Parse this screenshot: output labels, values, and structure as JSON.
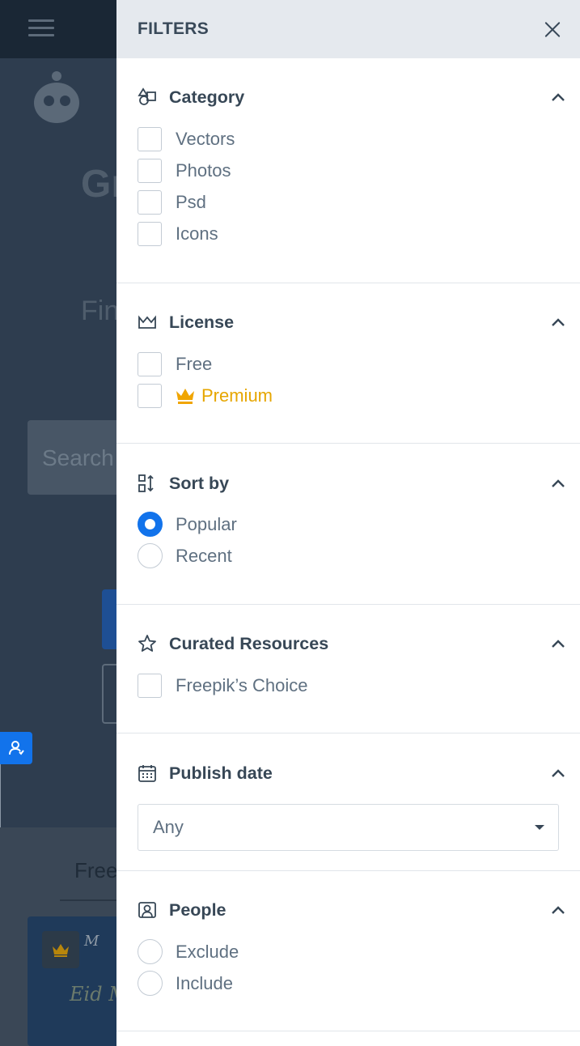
{
  "background": {
    "heading_fragment": "Gr",
    "subheading_fragment": "Fin",
    "search_placeholder": "Search",
    "tab_label": "Free",
    "card_title_fragment": "cial M",
    "card_subtitle_fragment": "Eid M"
  },
  "filters": {
    "title": "FILTERS",
    "close_icon": "close-icon",
    "sections": {
      "category": {
        "title": "Category",
        "icon": "shapes-icon",
        "options": [
          "Vectors",
          "Photos",
          "Psd",
          "Icons"
        ]
      },
      "license": {
        "title": "License",
        "icon": "crown-outline-icon",
        "options": [
          "Free",
          "Premium"
        ],
        "premium_color": "#e6a600"
      },
      "sort": {
        "title": "Sort by",
        "icon": "sort-icon",
        "options": [
          "Popular",
          "Recent"
        ],
        "selected": "Popular",
        "accent_color": "#1273eb"
      },
      "curated": {
        "title": "Curated Resources",
        "icon": "star-icon",
        "options": [
          "Freepik’s Choice"
        ]
      },
      "publish_date": {
        "title": "Publish date",
        "icon": "calendar-icon",
        "select_value": "Any"
      },
      "people": {
        "title": "People",
        "icon": "person-frame-icon",
        "options": [
          "Exclude",
          "Include"
        ]
      }
    }
  }
}
